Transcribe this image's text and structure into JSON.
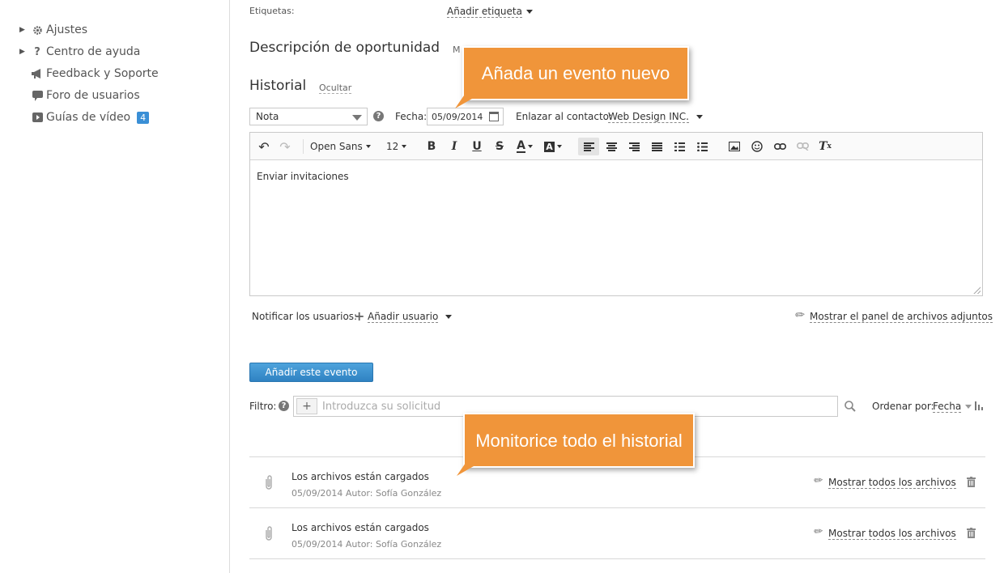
{
  "sidebar": {
    "items": [
      {
        "label": "Ajustes",
        "icon": "gear-icon",
        "expandable": true
      },
      {
        "label": "Centro de ayuda",
        "icon": "question-icon",
        "expandable": true
      },
      {
        "label": "Feedback y Soporte",
        "icon": "megaphone-icon",
        "expandable": false
      },
      {
        "label": "Foro de usuarios",
        "icon": "chat-bubble-icon",
        "expandable": false
      },
      {
        "label": "Guías de vídeo",
        "icon": "video-icon",
        "expandable": false,
        "badge": "4"
      }
    ]
  },
  "tags": {
    "label": "Etiquetas:",
    "add_label": "Añadir etiqueta"
  },
  "description": {
    "title": "Descripción de oportunidad",
    "link": "M"
  },
  "history": {
    "title": "Historial",
    "hide_link": "Ocultar",
    "type_value": "Nota",
    "date_label": "Fecha:",
    "date_value": "05/09/2014",
    "link_contact_label": "Enlazar al contacto:",
    "contact_value": "Web Design INC.",
    "editor": {
      "font_name": "Open Sans",
      "font_size": "12",
      "content": "Enviar invitaciones"
    },
    "notify_label": "Notificar los usuarios:",
    "add_user_label": "Añadir usuario",
    "attachments_panel_label": "Mostrar el panel de archivos adjuntos",
    "add_event_button": "Añadir este evento",
    "filter_label": "Filtro:",
    "filter_placeholder": "Introduzca su solicitud",
    "sort_label": "Ordenar por:",
    "sort_value": "Fecha",
    "entries": [
      {
        "title": "Los archivos están cargados",
        "meta": "05/09/2014 Autor: Sofía González",
        "action": "Mostrar todos los archivos"
      },
      {
        "title": "Los archivos están cargados",
        "meta": "05/09/2014 Autor: Sofía González",
        "action": "Mostrar todos los archivos"
      }
    ]
  },
  "callouts": {
    "new_event": "Añada un evento nuevo",
    "monitor": "Monitorice todo el historial"
  },
  "colors": {
    "accent_blue": "#2f82c2",
    "callout_orange": "#f0953a",
    "badge_blue": "#3a8fd6"
  }
}
